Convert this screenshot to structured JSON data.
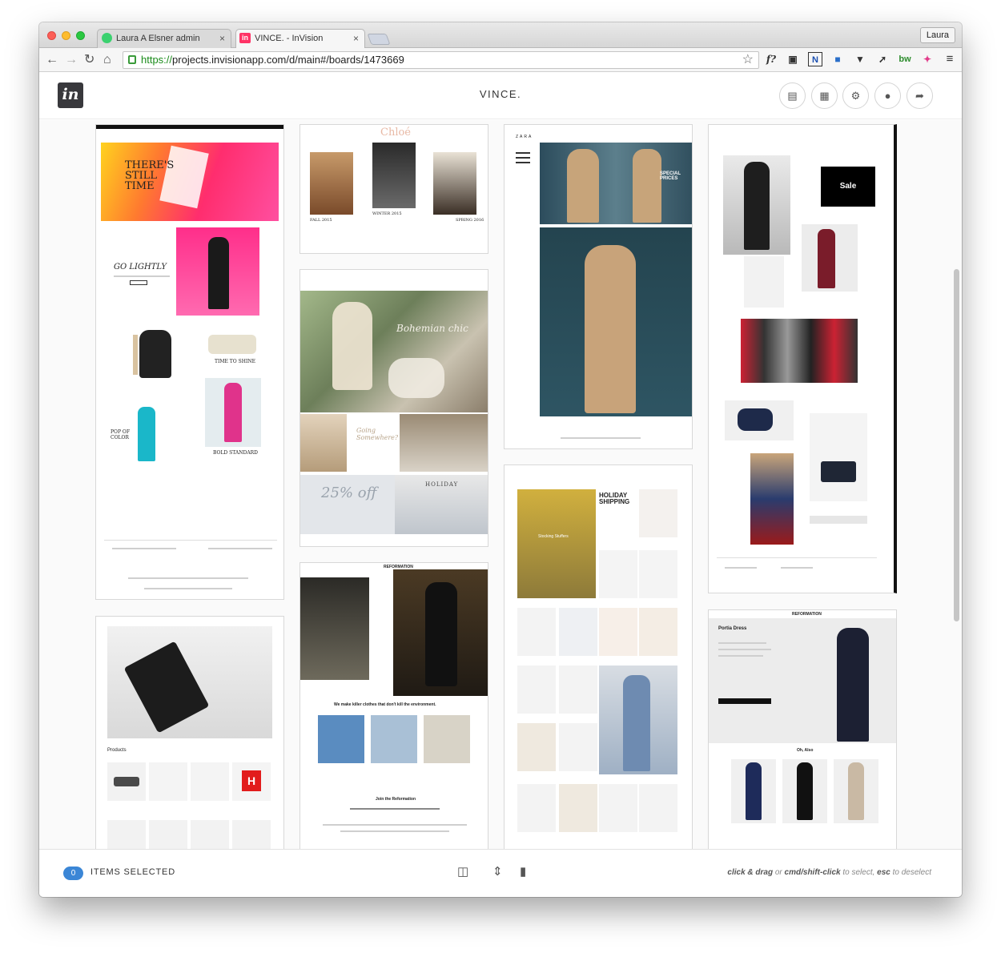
{
  "browser": {
    "tabs": [
      {
        "label": "Laura A Elsner admin",
        "close": "×"
      },
      {
        "label": "VINCE. - InVision",
        "close": "×",
        "favicon": "in"
      }
    ],
    "profile": "Laura",
    "url_scheme": "https://",
    "url_rest": "projects.invisionapp.com/d/main#/boards/1473669",
    "extensions": [
      "f?",
      "N",
      "bw"
    ]
  },
  "app": {
    "logo": "in",
    "board_title": "VINCE."
  },
  "cards": {
    "dvf": {
      "hero": "THERE'S STILL TIME",
      "golightly": "GO LIGHTLY",
      "timetoshine": "TIME TO SHINE",
      "pop": "POP OF COLOR",
      "bold": "BOLD STANDARD"
    },
    "chloe": {
      "brand": "Chloé",
      "fall": "FALL 2015",
      "winter": "WINTER 2015",
      "spring": "SPRING 2016"
    },
    "boho": {
      "headline": "Bohemian chic",
      "going": "Going Somewhere?",
      "sale": "25% off",
      "holiday": "HOLIDAY"
    },
    "reformation1": {
      "brand": "REFORMATION",
      "tagline": "We make killer clothes that don't kill the environment.",
      "join": "Join the Reformation"
    },
    "zara": {
      "brand": "ZARA",
      "special": "SPECIAL PRICES"
    },
    "need": {
      "headline": "HOLIDAY SHIPPING",
      "stocking": "Stocking Stuffers"
    },
    "mrporter": {
      "sale": "Sale"
    },
    "reformation2": {
      "brand": "REFORMATION",
      "product": "Portia Dress",
      "also": "Oh, Also"
    },
    "products": {
      "label": "Products",
      "h": "H"
    }
  },
  "footer": {
    "count": "0",
    "items_selected": "ITEMS SELECTED",
    "hint_a": "click & drag",
    "hint_b": " or ",
    "hint_c": "cmd/shift-click",
    "hint_d": " to select, ",
    "hint_e": "esc",
    "hint_f": " to deselect"
  },
  "colors": {
    "accent": "#3b86d6",
    "invision_pink": "#ff3366"
  }
}
